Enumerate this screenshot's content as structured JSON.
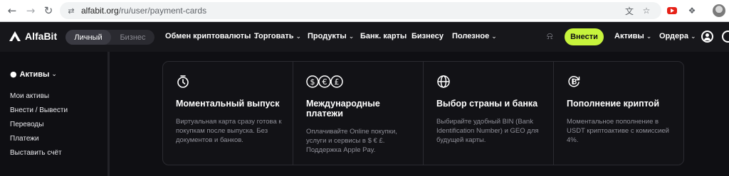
{
  "browser": {
    "url_domain": "alfabit.org",
    "url_path": "/ru/user/payment-cards",
    "back_icon": "arrow-left",
    "forward_icon": "arrow-right",
    "reload_icon": "reload",
    "site_info_icon": "tune",
    "translate_icon": "translate",
    "bookmark_icon": "star",
    "youtube_ext_icon": "youtube",
    "extensions_icon": "puzzle",
    "profile_icon": "avatar"
  },
  "header": {
    "logo_text": "AlfaBit",
    "toggle": {
      "active": "Личный",
      "inactive": "Бизнес"
    },
    "menu": [
      {
        "label": "Обмен криптовалюты",
        "dropdown": true
      },
      {
        "label": "Торговать",
        "dropdown": true
      },
      {
        "label": "Продукты",
        "dropdown": true
      },
      {
        "label": "Банк. карты",
        "dropdown": false
      },
      {
        "label": "Бизнесу",
        "dropdown": false
      },
      {
        "label": "Полезное",
        "dropdown": true
      }
    ],
    "enter_button": "Внести",
    "right_menu": [
      {
        "label": "Активы",
        "dropdown": true
      },
      {
        "label": "Ордера",
        "dropdown": true
      }
    ],
    "accent_color": "#c7f43c"
  },
  "sidebar": {
    "heading": "Активы",
    "items": [
      {
        "label": "Мои активы"
      },
      {
        "label": "Внести / Вывести"
      },
      {
        "label": "Переводы"
      },
      {
        "label": "Платежи"
      },
      {
        "label": "Выставить счёт"
      }
    ]
  },
  "features": [
    {
      "icon": "timer-card-icon",
      "title": "Моментальный выпуск",
      "description": "Виртуальная карта сразу готова к покупкам после выпуска. Без документов и банков."
    },
    {
      "icon": "currencies-icon",
      "icon_symbols": [
        "$",
        "€",
        "£"
      ],
      "title": "Международные платежи",
      "description": "Оплачивайте Online покупки, услуги и сервисы в $ € £. Поддержка Apple Pay."
    },
    {
      "icon": "globe-icon",
      "title": "Выбор страны и банка",
      "description": "Выбирайте удобный BIN (Bank Identification Number) и GEO для будущей карты."
    },
    {
      "icon": "crypto-topup-icon",
      "title": "Пополнение криптой",
      "description": "Моментальное пополнение в USDT криптоактиве с комиссией 4%."
    }
  ]
}
